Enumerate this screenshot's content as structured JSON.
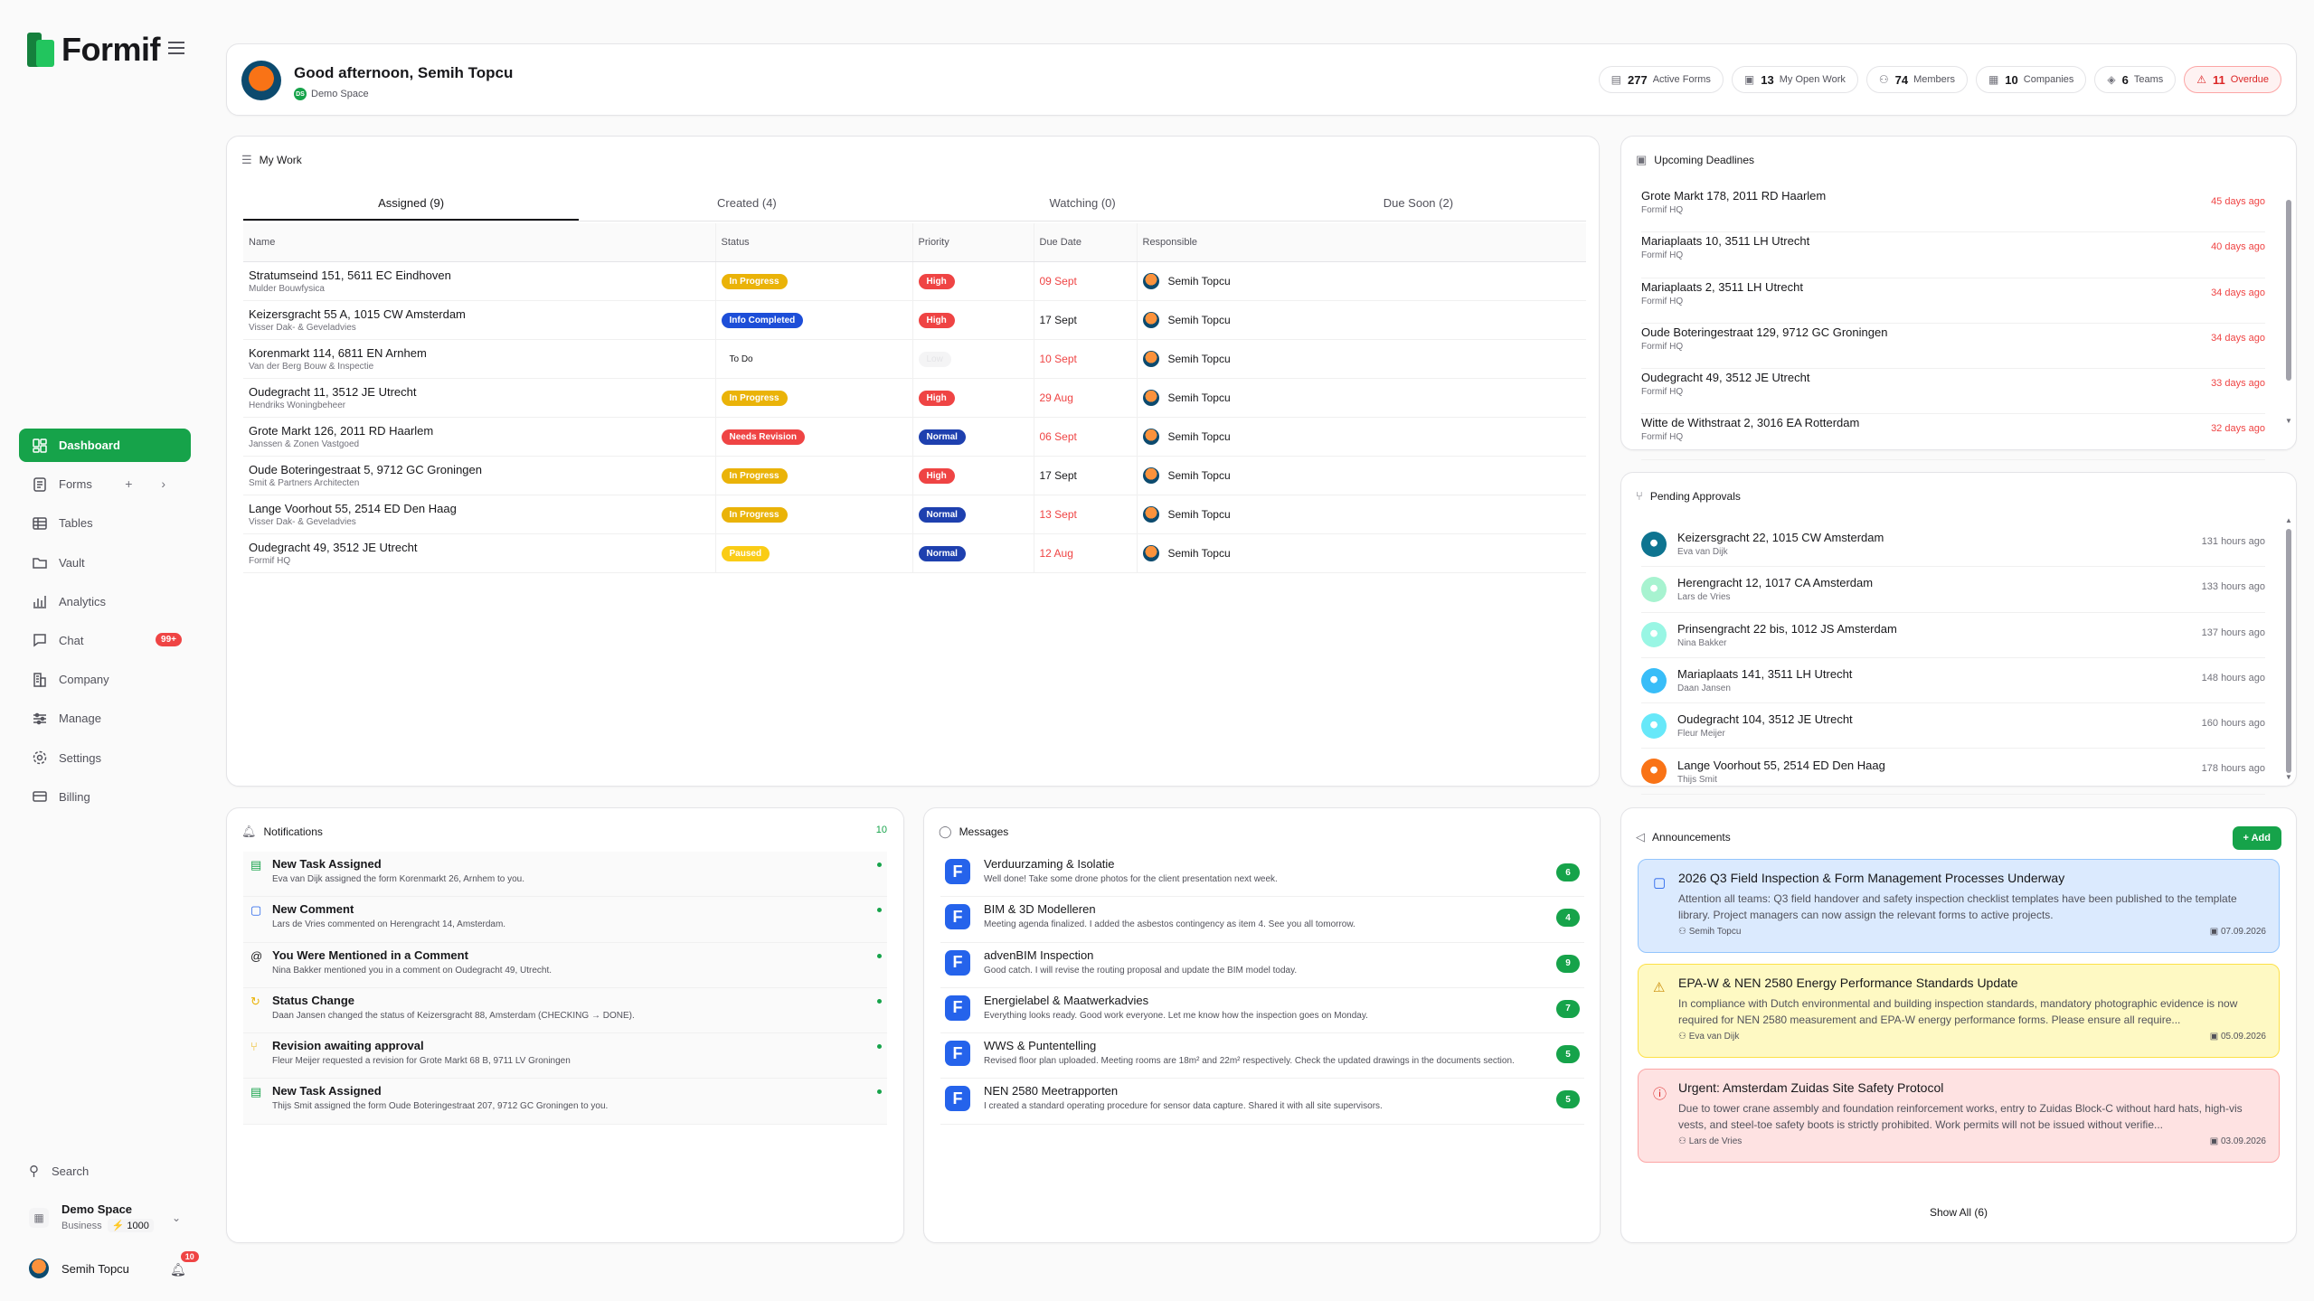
{
  "app": {
    "name": "Formif"
  },
  "sidebar": {
    "items": [
      {
        "label": "Dashboard",
        "icon": "dashboard-icon",
        "active": true
      },
      {
        "label": "Forms",
        "icon": "forms-icon",
        "extra": "+ ›"
      },
      {
        "label": "Tables",
        "icon": "tables-icon"
      },
      {
        "label": "Vault",
        "icon": "vault-icon"
      },
      {
        "label": "Analytics",
        "icon": "analytics-icon"
      },
      {
        "label": "Chat",
        "icon": "chat-icon",
        "badge": "99+"
      },
      {
        "label": "Company",
        "icon": "company-icon"
      },
      {
        "label": "Manage",
        "icon": "manage-icon"
      },
      {
        "label": "Settings",
        "icon": "settings-icon"
      },
      {
        "label": "Billing",
        "icon": "billing-icon"
      }
    ],
    "search_label": "Search",
    "space": {
      "name": "Demo Space",
      "plan": "Business",
      "credits": "1000"
    },
    "user": {
      "name": "Semih Topcu",
      "notifications": "10"
    }
  },
  "header": {
    "greeting": "Good afternoon, Semih Topcu",
    "space_badge": "DS",
    "space": "Demo Space",
    "stats": [
      {
        "icon": "▤",
        "value": "277",
        "label": "Active Forms"
      },
      {
        "icon": "▣",
        "value": "13",
        "label": "My Open Work"
      },
      {
        "icon": "⚇",
        "value": "74",
        "label": "Members"
      },
      {
        "icon": "▦",
        "value": "10",
        "label": "Companies"
      },
      {
        "icon": "◈",
        "value": "6",
        "label": "Teams"
      },
      {
        "icon": "⚠",
        "value": "11",
        "label": "Overdue",
        "alert": true
      }
    ]
  },
  "my_work": {
    "title": "My Work",
    "tabs": [
      {
        "label": "Assigned (9)",
        "active": true
      },
      {
        "label": "Created (4)"
      },
      {
        "label": "Watching (0)"
      },
      {
        "label": "Due Soon (2)"
      }
    ],
    "columns": [
      "Name",
      "Status",
      "Priority",
      "Due Date",
      "Responsible"
    ],
    "rows": [
      {
        "name": "Stratumseind 151, 5611 EC Eindhoven",
        "company": "Mulder Bouwfysica",
        "status": "In Progress",
        "priority": "High",
        "due": "09 Sept",
        "overdue": true,
        "responsible": "Semih Topcu"
      },
      {
        "name": "Keizersgracht 55 A, 1015 CW Amsterdam",
        "company": "Visser Dak- & Geveladvies",
        "status": "Info Completed",
        "priority": "High",
        "due": "17 Sept",
        "overdue": false,
        "responsible": "Semih Topcu"
      },
      {
        "name": "Korenmarkt 114, 6811 EN Arnhem",
        "company": "Van der Berg Bouw & Inspectie",
        "status": "To Do",
        "priority": "Low",
        "due": "10 Sept",
        "overdue": true,
        "responsible": "Semih Topcu"
      },
      {
        "name": "Oudegracht 11, 3512 JE Utrecht",
        "company": "Hendriks Woningbeheer",
        "status": "In Progress",
        "priority": "High",
        "due": "29 Aug",
        "overdue": true,
        "responsible": "Semih Topcu"
      },
      {
        "name": "Grote Markt 126, 2011 RD Haarlem",
        "company": "Janssen & Zonen Vastgoed",
        "status": "Needs Revision",
        "priority": "Normal",
        "due": "06 Sept",
        "overdue": true,
        "responsible": "Semih Topcu"
      },
      {
        "name": "Oude Boteringestraat 5, 9712 GC Groningen",
        "company": "Smit & Partners Architecten",
        "status": "In Progress",
        "priority": "High",
        "due": "17 Sept",
        "overdue": false,
        "responsible": "Semih Topcu"
      },
      {
        "name": "Lange Voorhout 55, 2514 ED Den Haag",
        "company": "Visser Dak- & Geveladvies",
        "status": "In Progress",
        "priority": "Normal",
        "due": "13 Sept",
        "overdue": true,
        "responsible": "Semih Topcu"
      },
      {
        "name": "Oudegracht 49, 3512 JE Utrecht",
        "company": "Formif HQ",
        "status": "Paused",
        "priority": "Normal",
        "due": "12 Aug",
        "overdue": true,
        "responsible": "Semih Topcu"
      }
    ]
  },
  "deadlines": {
    "title": "Upcoming Deadlines",
    "items": [
      {
        "name": "Grote Markt 178, 2011 RD Haarlem",
        "company": "Formif HQ",
        "due": "45 days ago"
      },
      {
        "name": "Mariaplaats 10, 3511 LH Utrecht",
        "company": "Formif HQ",
        "due": "40 days ago"
      },
      {
        "name": "Mariaplaats 2, 3511 LH Utrecht",
        "company": "Formif HQ",
        "due": "34 days ago"
      },
      {
        "name": "Oude Boteringestraat 129, 9712 GC Groningen",
        "company": "Formif HQ",
        "due": "34 days ago"
      },
      {
        "name": "Oudegracht 49, 3512 JE Utrecht",
        "company": "Formif HQ",
        "due": "33 days ago"
      },
      {
        "name": "Witte de Withstraat 2, 3016 EA Rotterdam",
        "company": "Formif HQ",
        "due": "32 days ago"
      }
    ]
  },
  "approvals": {
    "title": "Pending Approvals",
    "items": [
      {
        "name": "Keizersgracht 22, 1015 CW Amsterdam",
        "person": "Eva van Dijk",
        "time": "131 hours ago",
        "avatar_color": "#0e7490"
      },
      {
        "name": "Herengracht 12, 1017 CA Amsterdam",
        "person": "Lars de Vries",
        "time": "133 hours ago",
        "avatar_color": "#a7f3d0"
      },
      {
        "name": "Prinsengracht 22 bis, 1012 JS Amsterdam",
        "person": "Nina Bakker",
        "time": "137 hours ago",
        "avatar_color": "#99f6e4"
      },
      {
        "name": "Mariaplaats 141, 3511 LH Utrecht",
        "person": "Daan Jansen",
        "time": "148 hours ago",
        "avatar_color": "#38bdf8"
      },
      {
        "name": "Oudegracht 104, 3512 JE Utrecht",
        "person": "Fleur Meijer",
        "time": "160 hours ago",
        "avatar_color": "#67e8f9"
      },
      {
        "name": "Lange Voorhout 55, 2514 ED Den Haag",
        "person": "Thijs Smit",
        "time": "178 hours ago",
        "avatar_color": "#f97316"
      }
    ]
  },
  "notifications": {
    "title": "Notifications",
    "count": "10",
    "items": [
      {
        "icon": "▤",
        "title": "New Task Assigned",
        "text": "Eva van Dijk assigned the form Korenmarkt 26, Arnhem to you."
      },
      {
        "icon": "▢",
        "title": "New Comment",
        "text": "Lars de Vries commented on Herengracht 14, Amsterdam."
      },
      {
        "icon": "@",
        "title": "You Were Mentioned in a Comment",
        "text": "Nina Bakker mentioned you in a comment on Oudegracht 49, Utrecht."
      },
      {
        "icon": "↻",
        "title": "Status Change",
        "text": "Daan Jansen changed the status of Keizersgracht 88, Amsterdam (CHECKING → DONE)."
      },
      {
        "icon": "⑂",
        "title": "Revision awaiting approval",
        "text": "Fleur Meijer requested a revision for Grote Markt 68 B, 9711 LV Groningen"
      },
      {
        "icon": "▤",
        "title": "New Task Assigned",
        "text": "Thijs Smit assigned the form Oude Boteringestraat 207, 9712 GC Groningen to you."
      }
    ]
  },
  "messages": {
    "title": "Messages",
    "items": [
      {
        "title": "Verduurzaming & Isolatie",
        "text": "Well done! Take some drone photos for the client presentation next week.",
        "count": "6"
      },
      {
        "title": "BIM & 3D Modelleren",
        "text": "Meeting agenda finalized. I added the asbestos contingency as item 4. See you all tomorrow.",
        "count": "4"
      },
      {
        "title": "advenBIM Inspection",
        "text": "Good catch. I will revise the routing proposal and update the BIM model today.",
        "count": "9"
      },
      {
        "title": "Energielabel & Maatwerkadvies",
        "text": "Everything looks ready. Good work everyone. Let me know how the inspection goes on Monday.",
        "count": "7"
      },
      {
        "title": "WWS & Puntentelling",
        "text": "Revised floor plan uploaded. Meeting rooms are 18m² and 22m² respectively. Check the updated drawings in the documents section.",
        "count": "5"
      },
      {
        "title": "NEN 2580 Meetrapporten",
        "text": "I created a standard operating procedure for sensor data capture. Shared it with all site supervisors.",
        "count": "5"
      }
    ]
  },
  "announcements": {
    "title": "Announcements",
    "add_label": "+ Add",
    "show_all": "Show All (6)",
    "items": [
      {
        "title": "2026 Q3 Field Inspection & Form Management Processes Underway",
        "text": "Attention all teams: Q3 field handover and safety inspection checklist templates have been published to the template library. Project managers can now assign the relevant forms to active projects.",
        "author": "Semih Topcu",
        "date": "07.09.2026",
        "bg": "#dbeafe",
        "border": "#93c5fd",
        "icon": "▢",
        "icon_color": "#2563eb"
      },
      {
        "title": "EPA-W & NEN 2580 Energy Performance Standards Update",
        "text": "In compliance with Dutch environmental and building inspection standards, mandatory photographic evidence is now required for NEN 2580 measurement and EPA-W energy performance forms. Please ensure all require...",
        "author": "Eva van Dijk",
        "date": "05.09.2026",
        "bg": "#fef9c3",
        "border": "#fde047",
        "icon": "⚠",
        "icon_color": "#ca8a04"
      },
      {
        "title": "Urgent: Amsterdam Zuidas Site Safety Protocol",
        "text": "Due to tower crane assembly and foundation reinforcement works, entry to Zuidas Block-C without hard hats, high-vis vests, and steel-toe safety boots is strictly prohibited. Work permits will not be issued without verifie...",
        "author": "Lars de Vries",
        "date": "03.09.2026",
        "bg": "#fee2e2",
        "border": "#fca5a5",
        "icon": "ⓘ",
        "icon_color": "#dc2626"
      }
    ]
  },
  "colors": {
    "accent": "#16a34a",
    "status": {
      "In Progress": "#eab308",
      "Info Completed": "#1d4ed8",
      "To Do": "#ffffff",
      "Needs Revision": "#ef4444",
      "Paused": "#facc15"
    },
    "priority": {
      "High": "#ef4444",
      "Normal": "#1e40af",
      "Low": "#f4f4f5"
    }
  }
}
